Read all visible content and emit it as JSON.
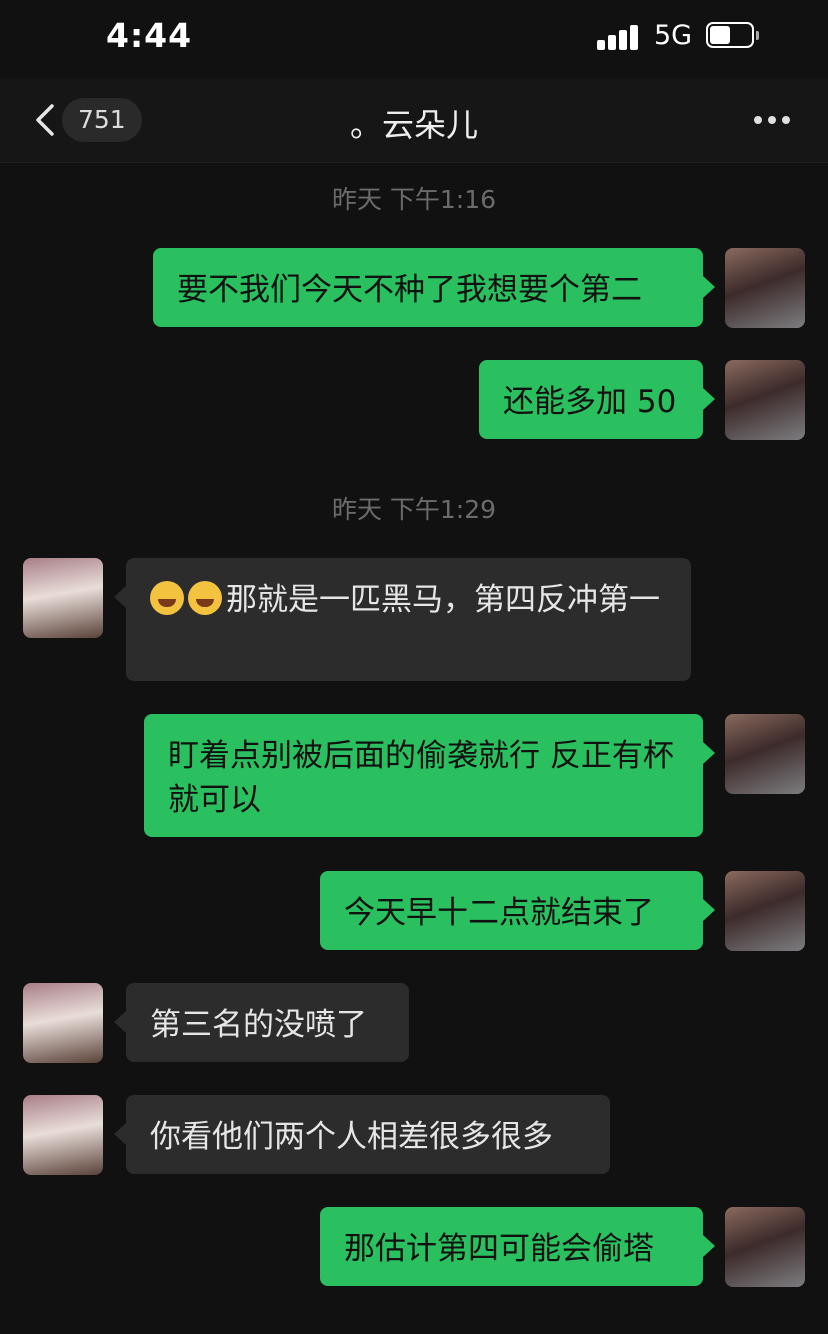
{
  "status": {
    "time": "4:44",
    "network": "5G"
  },
  "nav": {
    "unread_count": "751",
    "title": "。云朵儿"
  },
  "timestamps": [
    "昨天 下午1:16",
    "昨天 下午1:29"
  ],
  "messages": [
    {
      "from": "me",
      "text": "要不我们今天不种了我想要个第二"
    },
    {
      "from": "me",
      "text": "还能多加 50"
    },
    {
      "from": "them",
      "emoji": "crying-laughing-emoji",
      "text": "那就是一匹黑马，第四反冲第一"
    },
    {
      "from": "me",
      "text": "盯着点别被后面的偷袭就行 反正有杯就可以"
    },
    {
      "from": "me",
      "text": "今天早十二点就结束了"
    },
    {
      "from": "them",
      "text": "第三名的没喷了"
    },
    {
      "from": "them",
      "text": "你看他们两个人相差很多很多"
    },
    {
      "from": "me",
      "text": "那估计第四可能会偷塔"
    }
  ],
  "colors": {
    "background": "#111111",
    "outgoing_bubble": "#2bc05f",
    "incoming_bubble": "#2c2c2c",
    "timestamp": "#6b6b6b"
  }
}
